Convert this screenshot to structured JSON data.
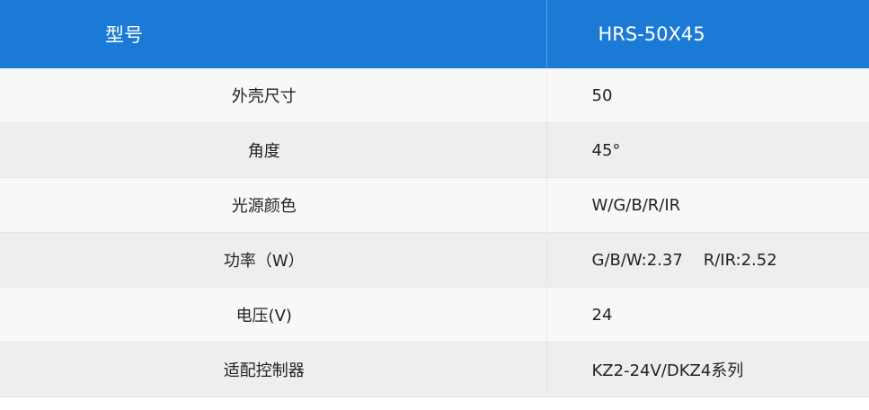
{
  "header": {
    "col1": "型号",
    "col2": "HRS-50X45"
  },
  "rows": [
    {
      "label": "外壳尺寸",
      "value": "50"
    },
    {
      "label": "角度",
      "value": "45°"
    },
    {
      "label": "光源颜色",
      "value": "W/G/B/R/IR"
    },
    {
      "label": "功率（W）",
      "value": "G/B/W:2.37    R/IR:2.52"
    },
    {
      "label": "电压(V)",
      "value": "24"
    },
    {
      "label": "适配控制器",
      "value": "KZ2-24V/DKZ4系列"
    }
  ]
}
